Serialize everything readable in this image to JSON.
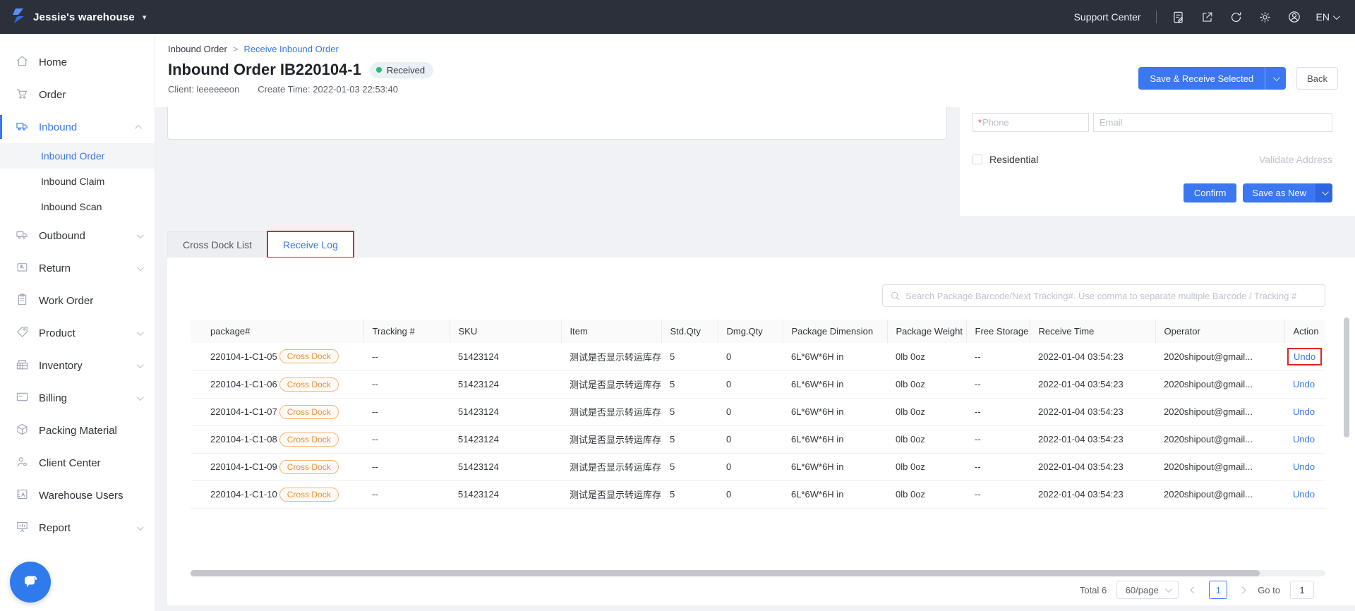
{
  "topbar": {
    "brand": "Jessie's warehouse",
    "support": "Support Center",
    "lang": "EN"
  },
  "sidebar": {
    "items": [
      {
        "label": "Home",
        "icon": "home-icon"
      },
      {
        "label": "Order",
        "icon": "cart-icon"
      },
      {
        "label": "Inbound",
        "icon": "inbound-truck-icon",
        "active": true,
        "expanded": true,
        "children": [
          "Inbound Order",
          "Inbound Claim",
          "Inbound Scan"
        ],
        "active_child": "Inbound Order"
      },
      {
        "label": "Outbound",
        "icon": "outbound-truck-icon"
      },
      {
        "label": "Return",
        "icon": "return-box-icon"
      },
      {
        "label": "Work Order",
        "icon": "clipboard-icon"
      },
      {
        "label": "Product",
        "icon": "tag-icon"
      },
      {
        "label": "Inventory",
        "icon": "shelf-icon"
      },
      {
        "label": "Billing",
        "icon": "card-icon"
      },
      {
        "label": "Packing Material",
        "icon": "cube-icon"
      },
      {
        "label": "Client Center",
        "icon": "person-gear-icon"
      },
      {
        "label": "Warehouse Users",
        "icon": "id-card-icon"
      },
      {
        "label": "Report",
        "icon": "presentation-icon"
      }
    ]
  },
  "breadcrumb": {
    "parent": "Inbound Order",
    "separator": ">",
    "current": "Receive Inbound Order"
  },
  "header": {
    "title": "Inbound Order IB220104-1",
    "status": "Received",
    "client_label": "Client:",
    "client": "leeeeeeon",
    "create_label": "Create Time:",
    "create_time": "2022-01-03 22:53:40",
    "save_receive_label": "Save & Receive Selected",
    "back_label": "Back"
  },
  "address_panel": {
    "phone_required_mark": "*",
    "phone_placeholder": "Phone",
    "email_placeholder": "Email",
    "residential_label": "Residential",
    "validate_address_label": "Validate Address",
    "confirm_label": "Confirm",
    "save_as_new_label": "Save as New"
  },
  "tabs": {
    "cross_dock": "Cross Dock List",
    "receive_log": "Receive Log"
  },
  "search": {
    "placeholder": "Search Package Barcode/Next Tracking#. Use comma to separate multiple Barcode / Tracking #"
  },
  "table": {
    "columns": [
      "package#",
      "Tracking #",
      "SKU",
      "Item",
      "Std.Qty",
      "Dmg.Qty",
      "Package Dimension",
      "Package Weight",
      "Free Storage",
      "Receive Time",
      "Operator",
      "Action"
    ],
    "rows": [
      {
        "package": "220104-1-C1-05",
        "badge": "Cross Dock",
        "tracking": "--",
        "sku": "51423124",
        "item": "测试是否显示转运库存",
        "std_qty": "5",
        "dmg_qty": "0",
        "dimension": "6L*6W*6H in",
        "weight": "0lb 0oz",
        "free_storage": "--",
        "receive_time": "2022-01-04 03:54:23",
        "operator": "2020shipout@gmail...",
        "action": "Undo"
      },
      {
        "package": "220104-1-C1-06",
        "badge": "Cross Dock",
        "tracking": "--",
        "sku": "51423124",
        "item": "测试是否显示转运库存",
        "std_qty": "5",
        "dmg_qty": "0",
        "dimension": "6L*6W*6H in",
        "weight": "0lb 0oz",
        "free_storage": "--",
        "receive_time": "2022-01-04 03:54:23",
        "operator": "2020shipout@gmail...",
        "action": "Undo"
      },
      {
        "package": "220104-1-C1-07",
        "badge": "Cross Dock",
        "tracking": "--",
        "sku": "51423124",
        "item": "测试是否显示转运库存",
        "std_qty": "5",
        "dmg_qty": "0",
        "dimension": "6L*6W*6H in",
        "weight": "0lb 0oz",
        "free_storage": "--",
        "receive_time": "2022-01-04 03:54:23",
        "operator": "2020shipout@gmail...",
        "action": "Undo"
      },
      {
        "package": "220104-1-C1-08",
        "badge": "Cross Dock",
        "tracking": "--",
        "sku": "51423124",
        "item": "测试是否显示转运库存",
        "std_qty": "5",
        "dmg_qty": "0",
        "dimension": "6L*6W*6H in",
        "weight": "0lb 0oz",
        "free_storage": "--",
        "receive_time": "2022-01-04 03:54:23",
        "operator": "2020shipout@gmail...",
        "action": "Undo"
      },
      {
        "package": "220104-1-C1-09",
        "badge": "Cross Dock",
        "tracking": "--",
        "sku": "51423124",
        "item": "测试是否显示转运库存",
        "std_qty": "5",
        "dmg_qty": "0",
        "dimension": "6L*6W*6H in",
        "weight": "0lb 0oz",
        "free_storage": "--",
        "receive_time": "2022-01-04 03:54:23",
        "operator": "2020shipout@gmail...",
        "action": "Undo"
      },
      {
        "package": "220104-1-C1-10",
        "badge": "Cross Dock",
        "tracking": "--",
        "sku": "51423124",
        "item": "测试是否显示转运库存",
        "std_qty": "5",
        "dmg_qty": "0",
        "dimension": "6L*6W*6H in",
        "weight": "0lb 0oz",
        "free_storage": "--",
        "receive_time": "2022-01-04 03:54:23",
        "operator": "2020shipout@gmail...",
        "action": "Undo"
      }
    ]
  },
  "pagination": {
    "total": "Total 6",
    "page_size": "60/page",
    "current_page": "1",
    "goto_label": "Go to",
    "goto_value": "1"
  },
  "ui_colors": {
    "primary": "#3a77f0",
    "annotation": "#e0241c",
    "badge_orange": "#e78f35",
    "status_green": "#26bf73",
    "topbar_bg": "#2b303b"
  }
}
